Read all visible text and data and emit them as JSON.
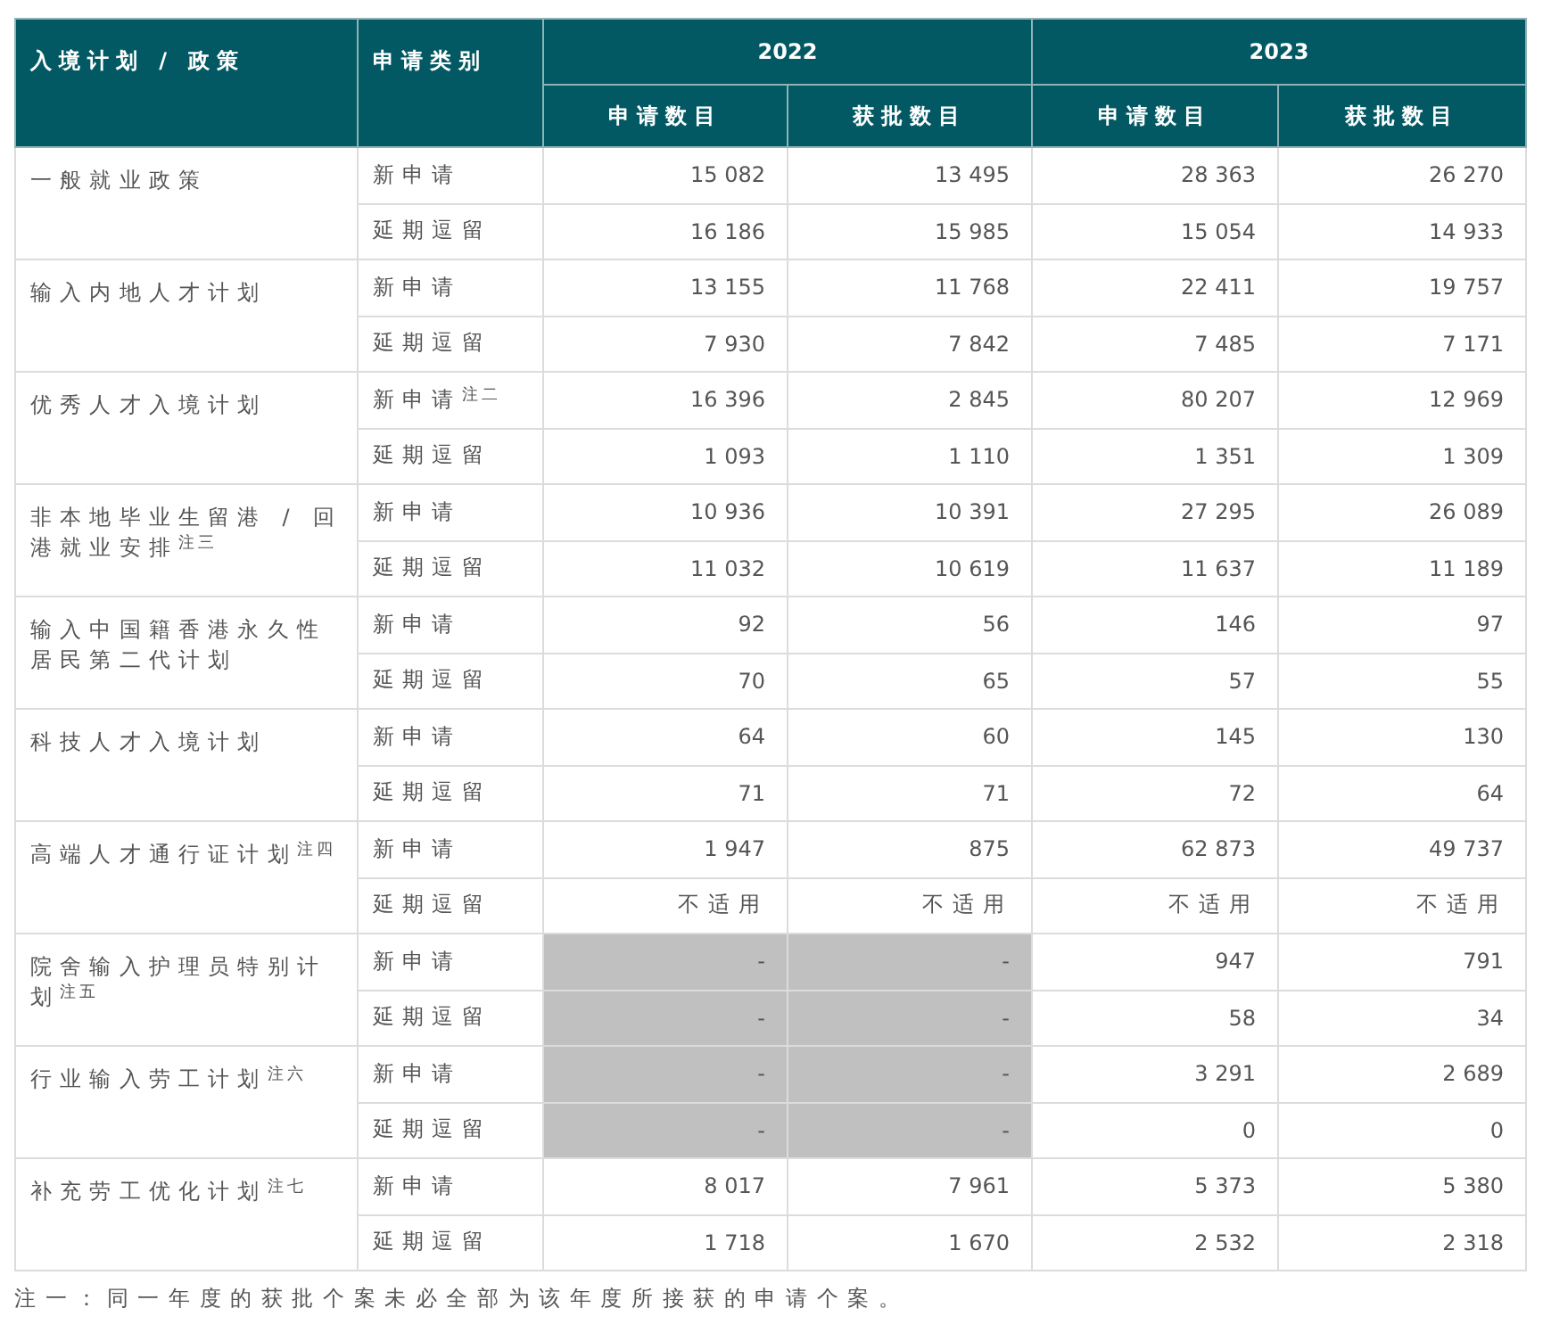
{
  "table": {
    "columns": {
      "scheme": "入境计划 / 政策",
      "category": "申请类别",
      "years": [
        {
          "year": "2022",
          "sub": [
            "申请数目",
            "获批数目"
          ]
        },
        {
          "year": "2023",
          "sub": [
            "申请数目",
            "获批数目"
          ]
        }
      ]
    },
    "rows": [
      {
        "scheme": "一般就业政策",
        "entries": [
          {
            "category": "新申请",
            "values": [
              "15 082",
              "13 495",
              "28 363",
              "26 270"
            ],
            "shaded": [
              false,
              false,
              false,
              false
            ]
          },
          {
            "category": "延期逗留",
            "values": [
              "16 186",
              "15 985",
              "15 054",
              "14 933"
            ],
            "shaded": [
              false,
              false,
              false,
              false
            ]
          }
        ]
      },
      {
        "scheme": "输入内地人才计划",
        "entries": [
          {
            "category": "新申请",
            "values": [
              "13 155",
              "11 768",
              "22 411",
              "19 757"
            ],
            "shaded": [
              false,
              false,
              false,
              false
            ]
          },
          {
            "category": "延期逗留",
            "values": [
              "7 930",
              "7 842",
              "7 485",
              "7 171"
            ],
            "shaded": [
              false,
              false,
              false,
              false
            ]
          }
        ]
      },
      {
        "scheme": "优秀人才入境计划",
        "entries": [
          {
            "category": "新申请$^{注二}$",
            "values": [
              "16 396",
              "2 845",
              "80 207",
              "12 969"
            ],
            "shaded": [
              false,
              false,
              false,
              false
            ]
          },
          {
            "category": "延期逗留",
            "values": [
              "1 093",
              "1 110",
              "1 351",
              "1 309"
            ],
            "shaded": [
              false,
              false,
              false,
              false
            ]
          }
        ]
      },
      {
        "scheme": "非本地毕业生留港 / 回港就业安排$^{注三}$",
        "entries": [
          {
            "category": "新申请",
            "values": [
              "10 936",
              "10 391",
              "27 295",
              "26 089"
            ],
            "shaded": [
              false,
              false,
              false,
              false
            ]
          },
          {
            "category": "延期逗留",
            "values": [
              "11 032",
              "10 619",
              "11 637",
              "11 189"
            ],
            "shaded": [
              false,
              false,
              false,
              false
            ]
          }
        ]
      },
      {
        "scheme": "输入中国籍香港永久性居民第二代计划",
        "entries": [
          {
            "category": "新申请",
            "values": [
              "92",
              "56",
              "146",
              "97"
            ],
            "shaded": [
              false,
              false,
              false,
              false
            ]
          },
          {
            "category": "延期逗留",
            "values": [
              "70",
              "65",
              "57",
              "55"
            ],
            "shaded": [
              false,
              false,
              false,
              false
            ]
          }
        ]
      },
      {
        "scheme": "科技人才入境计划",
        "entries": [
          {
            "category": "新申请",
            "values": [
              "64",
              "60",
              "145",
              "130"
            ],
            "shaded": [
              false,
              false,
              false,
              false
            ]
          },
          {
            "category": "延期逗留",
            "values": [
              "71",
              "71",
              "72",
              "64"
            ],
            "shaded": [
              false,
              false,
              false,
              false
            ]
          }
        ]
      },
      {
        "scheme": "高端人才通行证计划$^{注四}$",
        "entries": [
          {
            "category": "新申请",
            "values": [
              "1 947",
              "875",
              "62 873",
              "49 737"
            ],
            "shaded": [
              false,
              false,
              false,
              false
            ]
          },
          {
            "category": "延期逗留",
            "values": [
              "不适用",
              "不适用",
              "不适用",
              "不适用"
            ],
            "shaded": [
              false,
              false,
              false,
              false
            ]
          }
        ]
      },
      {
        "scheme": "院舍输入护理员特别计划$^{注五}$",
        "entries": [
          {
            "category": "新申请",
            "values": [
              "-",
              "-",
              "947",
              "791"
            ],
            "shaded": [
              true,
              true,
              false,
              false
            ]
          },
          {
            "category": "延期逗留",
            "values": [
              "-",
              "-",
              "58",
              "34"
            ],
            "shaded": [
              true,
              true,
              false,
              false
            ]
          }
        ]
      },
      {
        "scheme": "行业输入劳工计划$^{注六}$",
        "entries": [
          {
            "category": "新申请",
            "values": [
              "-",
              "-",
              "3 291",
              "2 689"
            ],
            "shaded": [
              true,
              true,
              false,
              false
            ]
          },
          {
            "category": "延期逗留",
            "values": [
              "-",
              "-",
              "0",
              "0"
            ],
            "shaded": [
              true,
              true,
              false,
              false
            ]
          }
        ]
      },
      {
        "scheme": "补充劳工优化计划$^{注七}$",
        "entries": [
          {
            "category": "新申请",
            "values": [
              "8 017",
              "7 961",
              "5 373",
              "5 380"
            ],
            "shaded": [
              false,
              false,
              false,
              false
            ]
          },
          {
            "category": "延期逗留",
            "values": [
              "1 718",
              "1 670",
              "2 532",
              "2 318"
            ],
            "shaded": [
              false,
              false,
              false,
              false
            ]
          }
        ]
      }
    ]
  },
  "footnote": "注一：同一年度的获批个案未必全部为该年度所接获的申请个案。"
}
